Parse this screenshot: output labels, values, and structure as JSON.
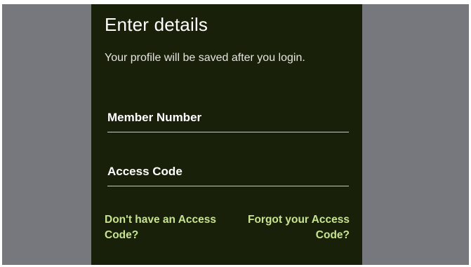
{
  "colors": {
    "backdrop": "#77787d",
    "panel_background": "#18200a",
    "text": "#ffffff",
    "link": "#c8e48f",
    "field_underline": "#c9ccc4"
  },
  "header": {
    "title": "Enter details",
    "subtitle": "Your profile will be saved after you login."
  },
  "form": {
    "member_number": {
      "placeholder": "Member Number",
      "value": ""
    },
    "access_code": {
      "placeholder": "Access Code",
      "value": ""
    }
  },
  "links": {
    "no_access_code": "Don't have an Access Code?",
    "forgot_access_code": "Forgot your Access Code?"
  }
}
